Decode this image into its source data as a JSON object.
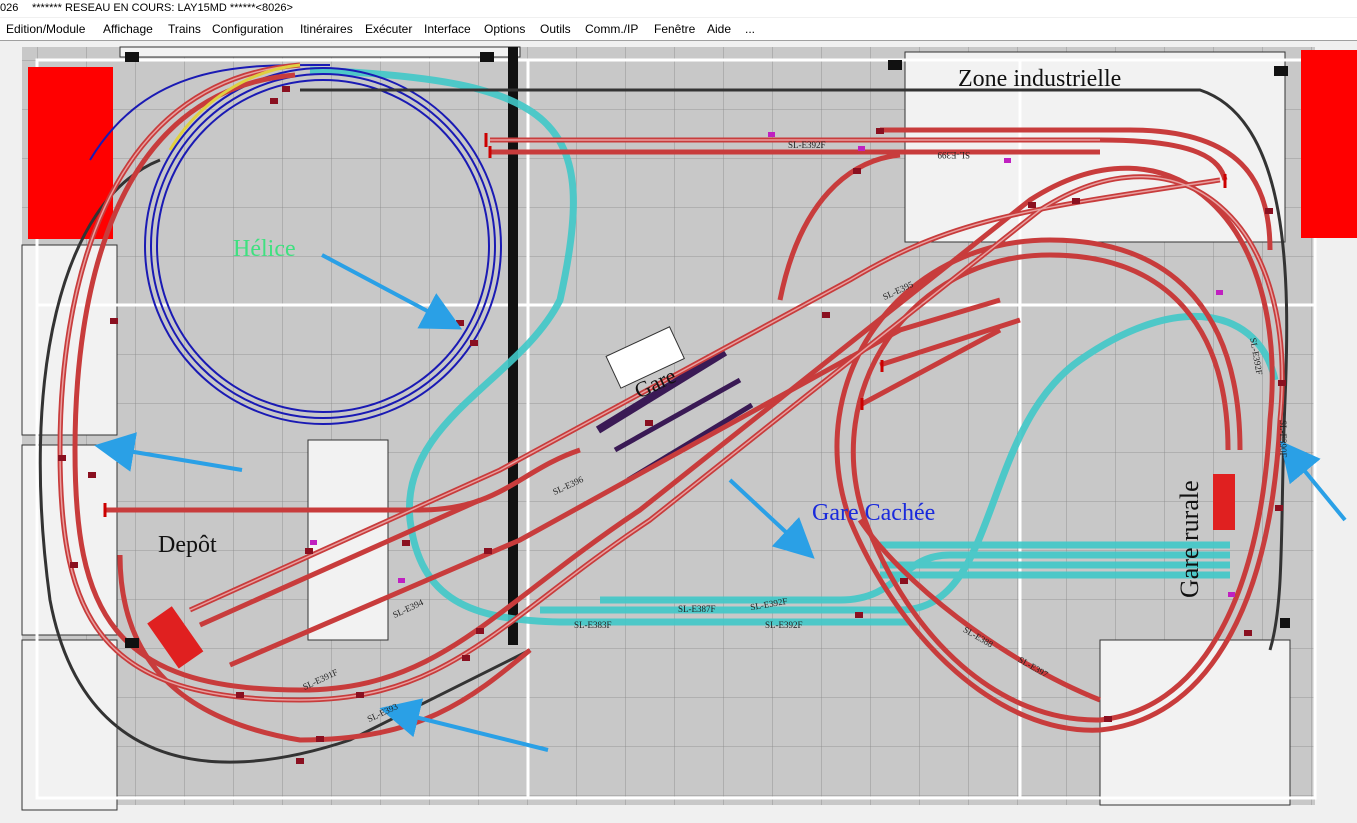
{
  "window": {
    "title_prefix": "026",
    "title": "******* RESEAU EN COURS: LAY15MD ******<8026>"
  },
  "menu": [
    "Edition/Module",
    "Affichage",
    "Trains",
    "Configuration",
    "Itinéraires",
    "Exécuter",
    "Interface",
    "Options",
    "Outils",
    "Comm./IP",
    "Fenêtre",
    "Aide",
    "..."
  ],
  "labels": {
    "zone": "Zone industrielle",
    "helice": "Hélice",
    "gare": "Gare",
    "gare_cachee": "Gare Cachée",
    "depot": "Depôt",
    "gare_rurale": "Gare rurale"
  },
  "track_labels": [
    "SL-E392F",
    "SL-E399",
    "SL-E392F",
    "SL-E387F",
    "SL-E383F",
    "SL-E392F",
    "SL-E397",
    "SL-E388",
    "SL-E396",
    "SL-E391F",
    "SL-E393",
    "SL-E394",
    "SL-E395",
    "SL-E390F",
    "SL-E392F"
  ],
  "colors": {
    "track": "#c83c3c",
    "hidden_track": "#40c8c8",
    "helix": "#1a1ab4",
    "building": "#ff0000",
    "grid": "#888888",
    "background": "#c8c8c8",
    "arrow": "#2aa0e6"
  }
}
